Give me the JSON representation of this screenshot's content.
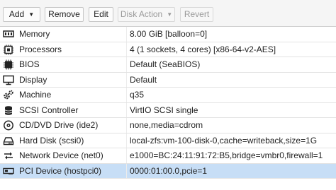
{
  "toolbar": {
    "add_label": "Add",
    "remove_label": "Remove",
    "edit_label": "Edit",
    "disk_action_label": "Disk Action",
    "revert_label": "Revert"
  },
  "hardware": [
    {
      "key": "Memory",
      "value": "8.00 GiB [balloon=0]",
      "icon": "memory-icon"
    },
    {
      "key": "Processors",
      "value": "4 (1 sockets, 4 cores) [x86-64-v2-AES]",
      "icon": "cpu-icon"
    },
    {
      "key": "BIOS",
      "value": "Default (SeaBIOS)",
      "icon": "chip-icon"
    },
    {
      "key": "Display",
      "value": "Default",
      "icon": "monitor-icon"
    },
    {
      "key": "Machine",
      "value": "q35",
      "icon": "cogs-icon"
    },
    {
      "key": "SCSI Controller",
      "value": "VirtIO SCSI single",
      "icon": "database-icon"
    },
    {
      "key": "CD/DVD Drive (ide2)",
      "value": "none,media=cdrom",
      "icon": "cdrom-icon"
    },
    {
      "key": "Hard Disk (scsi0)",
      "value": "local-zfs:vm-100-disk-0,cache=writeback,size=1G",
      "icon": "harddisk-icon"
    },
    {
      "key": "Network Device (net0)",
      "value": "e1000=BC:24:11:91:72:B5,bridge=vmbr0,firewall=1",
      "icon": "network-icon"
    },
    {
      "key": "PCI Device (hostpci0)",
      "value": "0000:01:00.0,pcie=1",
      "icon": "pci-card-icon"
    }
  ],
  "selected_index": 9
}
